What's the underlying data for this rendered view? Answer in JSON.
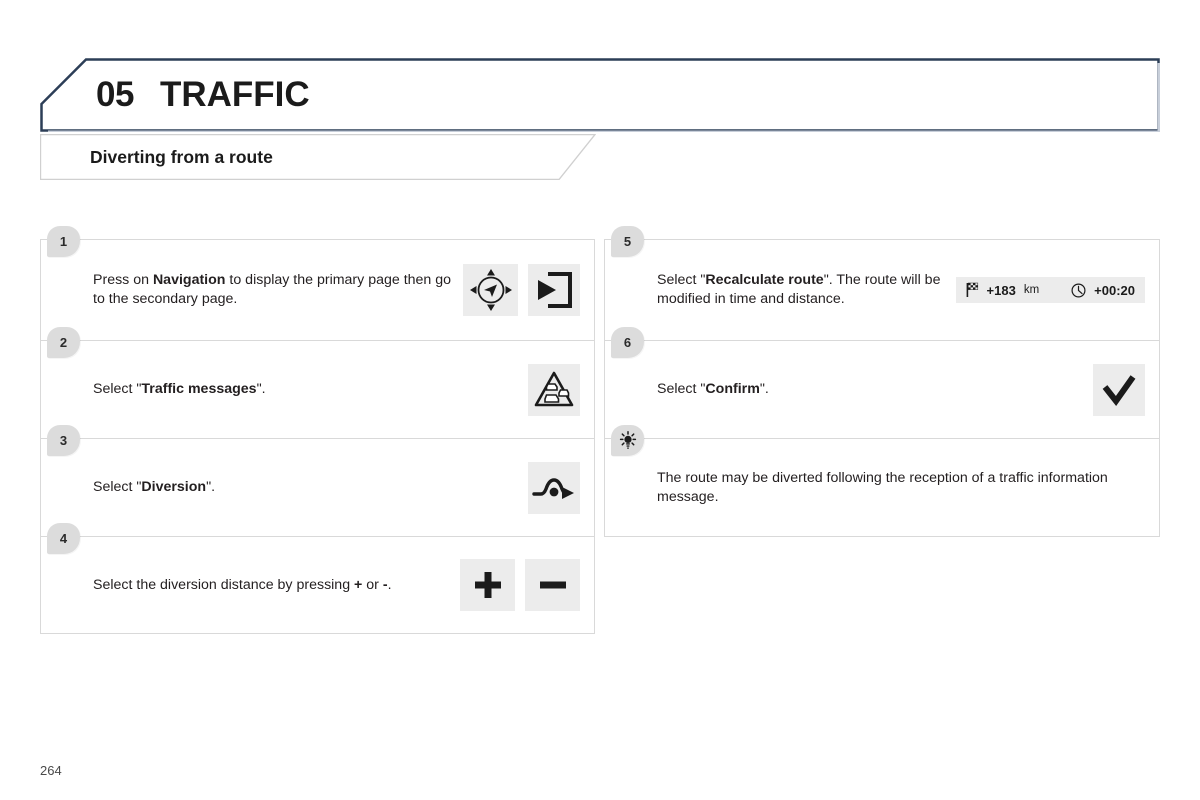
{
  "header": {
    "chapter_number": "05",
    "chapter_title": "TRAFFIC",
    "border_color": "#2c3e57"
  },
  "section": {
    "title": "Diverting from a route",
    "border_color": "#d0d0d0"
  },
  "footer": {
    "page_number": "264"
  },
  "left_column": {
    "steps": [
      {
        "badge": "1",
        "text_before": "Press on ",
        "text_bold": "Navigation",
        "text_after": " to display the primary page then go to the secondary page.",
        "icons": [
          "navigation-joystick-icon",
          "secondary-page-icon"
        ]
      },
      {
        "badge": "2",
        "text_before": "Select \"",
        "text_bold": "Traffic messages",
        "text_after": "\".",
        "icons": [
          "traffic-jam-warning-icon"
        ]
      },
      {
        "badge": "3",
        "text_before": "Select \"",
        "text_bold": "Diversion",
        "text_after": "\".",
        "icons": [
          "diversion-route-icon"
        ]
      },
      {
        "badge": "4",
        "text_before": "Select the diversion distance by pressing ",
        "text_bold": "+",
        "text_middle": " or ",
        "text_bold2": "-",
        "text_after": ".",
        "icons": [
          "plus-icon",
          "minus-icon"
        ]
      }
    ]
  },
  "right_column": {
    "steps": [
      {
        "badge": "5",
        "text_before": "Select \"",
        "text_bold": "Recalculate route",
        "text_after": "\". The route will be modified in time and distance.",
        "route_info": {
          "distance_icon": "checkered-flag-icon",
          "distance_value": "+183",
          "distance_unit": "km",
          "time_icon": "clock-icon",
          "time_value": "+00:20"
        }
      },
      {
        "badge": "6",
        "text_before": "Select \"",
        "text_bold": "Confirm",
        "text_after": "\".",
        "icons": [
          "checkmark-icon"
        ]
      },
      {
        "badge": "tip-bulb-icon",
        "is_tip": true,
        "text": "The route may be diverted following the reception of a traffic information message."
      }
    ]
  }
}
